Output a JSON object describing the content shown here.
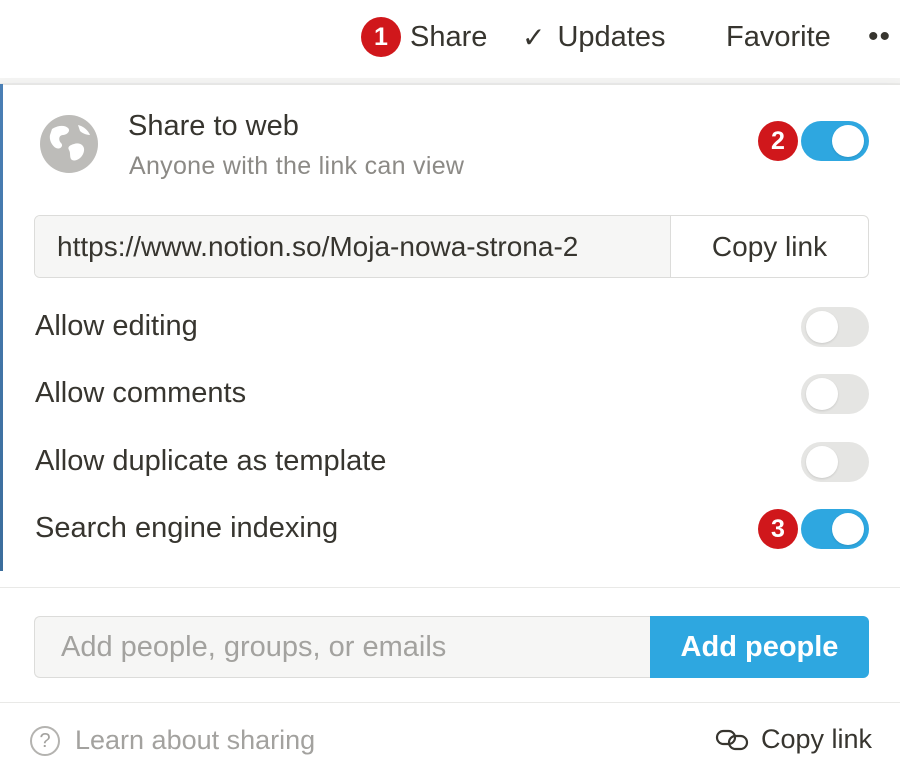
{
  "topbar": {
    "share_badge": "1",
    "share_label": "Share",
    "updates_icon": "checkmark-icon",
    "updates_label": "Updates",
    "favorite_label": "Favorite",
    "more_label": "••"
  },
  "share_to_web": {
    "icon": "globe-icon",
    "title": "Share to web",
    "subtitle": "Anyone with the link can view",
    "badge": "2",
    "enabled": true
  },
  "link": {
    "url": "https://www.notion.so/Moja-nowa-strona-2",
    "copy_label": "Copy link"
  },
  "options": [
    {
      "label": "Allow editing",
      "enabled": false
    },
    {
      "label": "Allow comments",
      "enabled": false
    },
    {
      "label": "Allow duplicate as template",
      "enabled": false
    },
    {
      "label": "Search engine indexing",
      "enabled": true,
      "badge": "3"
    }
  ],
  "invite": {
    "placeholder": "Add people, groups, or emails",
    "button_label": "Add people"
  },
  "footer": {
    "help_icon": "question-circle-icon",
    "learn_label": "Learn about sharing",
    "copy_icon": "link-icon",
    "copy_label": "Copy link"
  },
  "colors": {
    "accent": "#2ea7e0",
    "badge": "#d0171b",
    "toggle_off": "#e5e5e3",
    "text": "#37352f",
    "muted": "#8c8a86"
  }
}
